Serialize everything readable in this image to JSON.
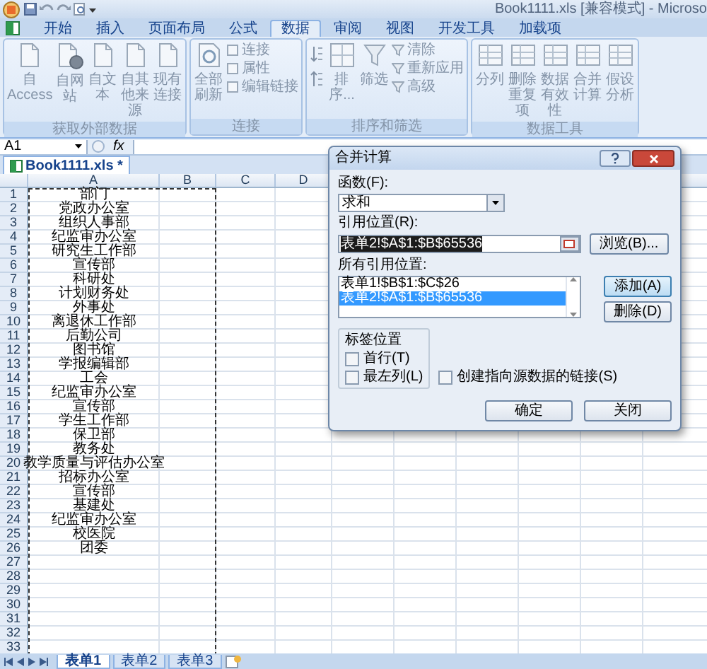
{
  "window": {
    "title": "Book1111.xls  [兼容模式] - Microso"
  },
  "ribbon_tabs": [
    {
      "label": "开始",
      "selected": false
    },
    {
      "label": "插入",
      "selected": false
    },
    {
      "label": "页面布局",
      "selected": false
    },
    {
      "label": "公式",
      "selected": false
    },
    {
      "label": "数据",
      "selected": true
    },
    {
      "label": "审阅",
      "selected": false
    },
    {
      "label": "视图",
      "selected": false
    },
    {
      "label": "开发工具",
      "selected": false
    },
    {
      "label": "加载项",
      "selected": false
    }
  ],
  "ribbon": {
    "disabled": true,
    "groups": [
      {
        "label": "获取外部数据",
        "sort_buttons": false,
        "large": [
          "自 Access",
          "自网站",
          "自文本",
          "自其他来源",
          "现有连接"
        ]
      },
      {
        "label": "连接",
        "sort_buttons": false,
        "large": [
          "全部刷新"
        ],
        "small": [
          "连接",
          "属性",
          "编辑链接"
        ]
      },
      {
        "label": "排序和筛选",
        "sort_buttons": true,
        "large": [
          "排序...",
          "筛选"
        ],
        "small": [
          "清除",
          "重新应用",
          "高级"
        ]
      },
      {
        "label": "数据工具",
        "sort_buttons": false,
        "large": [
          "分列",
          "删除重复项",
          "数据有效性",
          "合并计算",
          "假设分析"
        ]
      }
    ]
  },
  "name_box": "A1",
  "fx": "fx",
  "workbook_tab": "Book1111.xls *",
  "columns": [
    "A",
    "B",
    "C",
    "D"
  ],
  "rows": [
    {
      "number": "1",
      "a": "部门"
    },
    {
      "number": "2",
      "a": "党政办公室"
    },
    {
      "number": "3",
      "a": "组织人事部"
    },
    {
      "number": "4",
      "a": "纪监审办公室"
    },
    {
      "number": "5",
      "a": "研究生工作部"
    },
    {
      "number": "6",
      "a": "宣传部"
    },
    {
      "number": "7",
      "a": "科研处"
    },
    {
      "number": "8",
      "a": "计划财务处"
    },
    {
      "number": "9",
      "a": "外事处"
    },
    {
      "number": "10",
      "a": "离退休工作部"
    },
    {
      "number": "11",
      "a": "后勤公司"
    },
    {
      "number": "12",
      "a": "图书馆"
    },
    {
      "number": "13",
      "a": "学报编辑部"
    },
    {
      "number": "14",
      "a": "工会"
    },
    {
      "number": "15",
      "a": "纪监审办公室"
    },
    {
      "number": "16",
      "a": "宣传部"
    },
    {
      "number": "17",
      "a": "学生工作部"
    },
    {
      "number": "18",
      "a": "保卫部"
    },
    {
      "number": "19",
      "a": "教务处"
    },
    {
      "number": "20",
      "a": "教学质量与评估办公室"
    },
    {
      "number": "21",
      "a": "招标办公室"
    },
    {
      "number": "22",
      "a": "宣传部"
    },
    {
      "number": "23",
      "a": "基建处"
    },
    {
      "number": "24",
      "a": "纪监审办公室"
    },
    {
      "number": "25",
      "a": "校医院"
    },
    {
      "number": "26",
      "a": "团委"
    },
    {
      "number": "27"
    },
    {
      "number": "28"
    },
    {
      "number": "29"
    },
    {
      "number": "30"
    },
    {
      "number": "31"
    },
    {
      "number": "32"
    },
    {
      "number": "33"
    }
  ],
  "dialog": {
    "title": "合并计算",
    "function_label": "函数(F):",
    "function_value": "求和",
    "reference_label": "引用位置(R):",
    "reference_value": "表单2!$A$1:$B$65536",
    "reference_selected": true,
    "browse_button": "浏览(B)...",
    "all_references_label": "所有引用位置:",
    "references": [
      {
        "text": "表单1!$B$1:$C$26",
        "selected": false
      },
      {
        "text": "表单2!$A$1:$B$65536",
        "selected": true
      }
    ],
    "add_button": "添加(A)",
    "delete_button": "删除(D)",
    "labels_group": "标签位置",
    "options": [
      {
        "label": "首行(T)",
        "checked": false
      },
      {
        "label": "最左列(L)",
        "checked": false
      }
    ],
    "link_option": {
      "label": "创建指向源数据的链接(S)",
      "checked": false
    },
    "ok_button": "确定",
    "close_button": "关闭"
  },
  "sheet_tabs": [
    {
      "label": "表单1",
      "selected": true
    },
    {
      "label": "表单2",
      "selected": false
    },
    {
      "label": "表单3",
      "selected": false
    }
  ]
}
